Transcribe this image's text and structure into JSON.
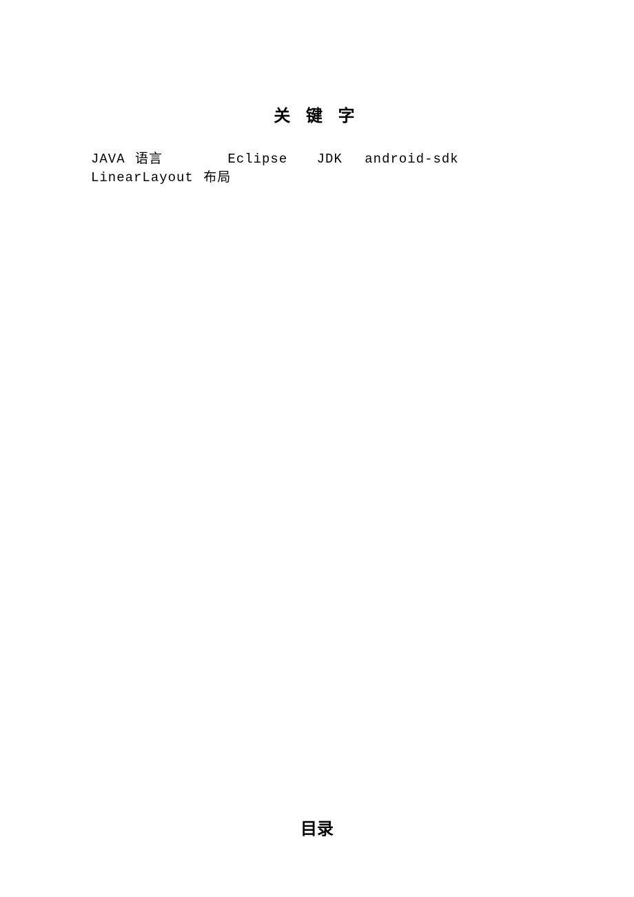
{
  "headings": {
    "keywords_title": "关 键 字",
    "toc_title": "目录"
  },
  "keywords": {
    "kw1": "JAVA 语言",
    "kw2": "Eclipse",
    "kw3": "JDK",
    "kw4": "android-sdk",
    "kw5": "LinearLayout 布局"
  }
}
